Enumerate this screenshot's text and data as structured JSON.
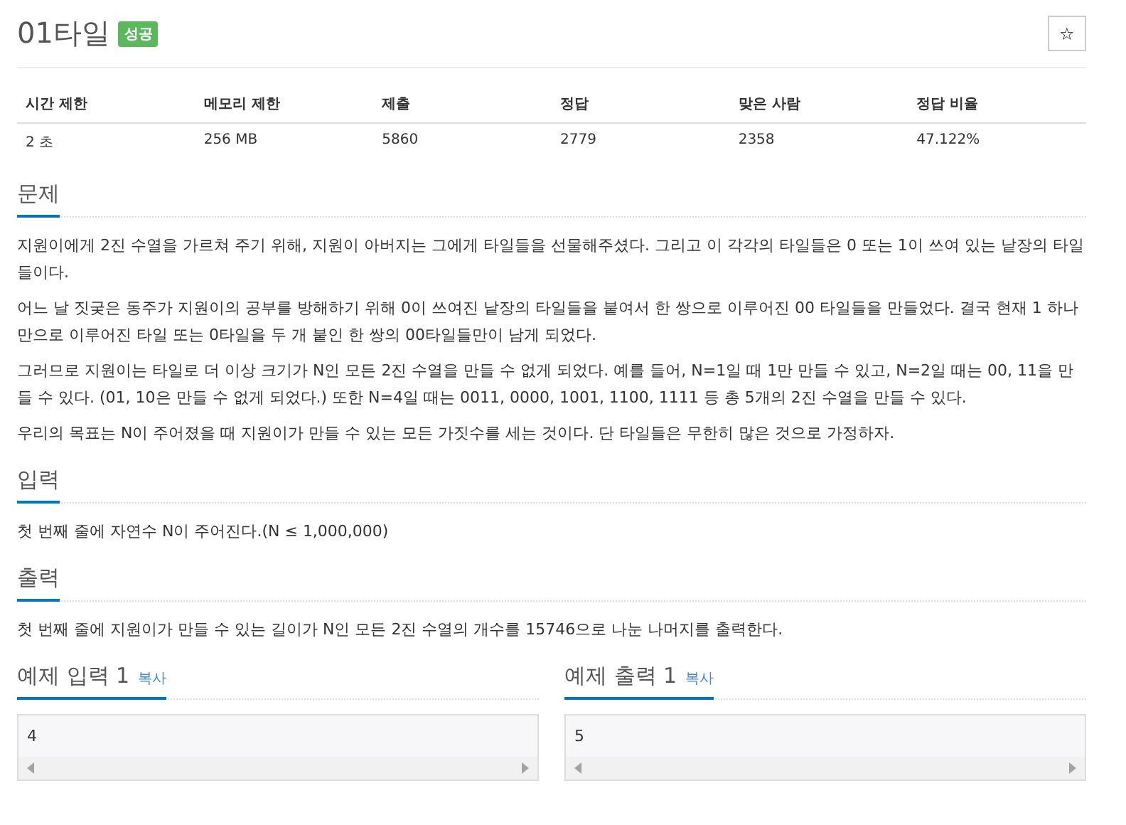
{
  "title": "01타일",
  "result_badge": "성공",
  "star_button": "☆",
  "stats": {
    "columns": [
      "시간 제한",
      "메모리 제한",
      "제출",
      "정답",
      "맞은 사람",
      "정답 비율"
    ],
    "rows": [
      [
        "2 초",
        "256 MB",
        "5860",
        "2779",
        "2358",
        "47.122%"
      ]
    ]
  },
  "sections": [
    {
      "heading": "문제",
      "paragraphs": [
        "지원이에게 2진 수열을 가르쳐 주기 위해, 지원이 아버지는 그에게 타일들을 선물해주셨다. 그리고 이 각각의 타일들은 0 또는 1이 쓰여 있는 낱장의 타일들이다.",
        "어느 날 짓궂은 동주가 지원이의 공부를 방해하기 위해 0이 쓰여진 낱장의 타일들을 붙여서 한 쌍으로 이루어진 00 타일들을 만들었다. 결국 현재 1 하나만으로 이루어진 타일 또는 0타일을 두 개 붙인 한 쌍의 00타일들만이 남게 되었다.",
        "그러므로 지원이는 타일로 더 이상 크기가 N인 모든 2진 수열을 만들 수 없게 되었다. 예를 들어, N=1일 때 1만 만들 수 있고, N=2일 때는 00, 11을 만들 수 있다. (01, 10은 만들 수 없게 되었다.) 또한 N=4일 때는 0011, 0000, 1001, 1100, 1111 등 총 5개의 2진 수열을 만들 수 있다.",
        "우리의 목표는 N이 주어졌을 때 지원이가 만들 수 있는 모든 가짓수를 세는 것이다. 단 타일들은 무한히 많은 것으로 가정하자."
      ]
    },
    {
      "heading": "입력",
      "paragraphs": [
        "첫 번째 줄에 자연수 N이 주어진다.(N ≤ 1,000,000)"
      ]
    },
    {
      "heading": "출력",
      "paragraphs": [
        "첫 번째 줄에 지원이가 만들 수 있는 길이가 N인 모든 2진 수열의 개수를 15746으로 나눈 나머지를 출력한다."
      ]
    }
  ],
  "samples": [
    {
      "heading": "예제 입력 1",
      "copy": "복사",
      "content": "4"
    },
    {
      "heading": "예제 출력 1",
      "copy": "복사",
      "content": "5"
    }
  ]
}
